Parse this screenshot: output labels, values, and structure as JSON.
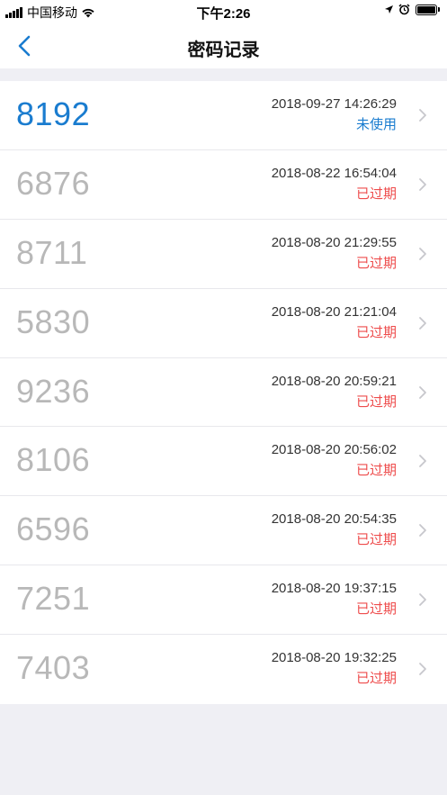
{
  "status_bar": {
    "carrier": "中国移动",
    "time": "下午2:26"
  },
  "nav": {
    "title": "密码记录",
    "back_icon": "chevron-left-icon"
  },
  "colors": {
    "accent": "#1a7ccf",
    "expired": "#ee4c4c",
    "code_inactive": "#b8b8b8"
  },
  "records": [
    {
      "code": "8192",
      "timestamp": "2018-09-27 14:26:29",
      "status": "未使用",
      "state": "unused"
    },
    {
      "code": "6876",
      "timestamp": "2018-08-22 16:54:04",
      "status": "已过期",
      "state": "expired"
    },
    {
      "code": "8711",
      "timestamp": "2018-08-20 21:29:55",
      "status": "已过期",
      "state": "expired"
    },
    {
      "code": "5830",
      "timestamp": "2018-08-20 21:21:04",
      "status": "已过期",
      "state": "expired"
    },
    {
      "code": "9236",
      "timestamp": "2018-08-20 20:59:21",
      "status": "已过期",
      "state": "expired"
    },
    {
      "code": "8106",
      "timestamp": "2018-08-20 20:56:02",
      "status": "已过期",
      "state": "expired"
    },
    {
      "code": "6596",
      "timestamp": "2018-08-20 20:54:35",
      "status": "已过期",
      "state": "expired"
    },
    {
      "code": "7251",
      "timestamp": "2018-08-20 19:37:15",
      "status": "已过期",
      "state": "expired"
    },
    {
      "code": "7403",
      "timestamp": "2018-08-20 19:32:25",
      "status": "已过期",
      "state": "expired"
    }
  ]
}
